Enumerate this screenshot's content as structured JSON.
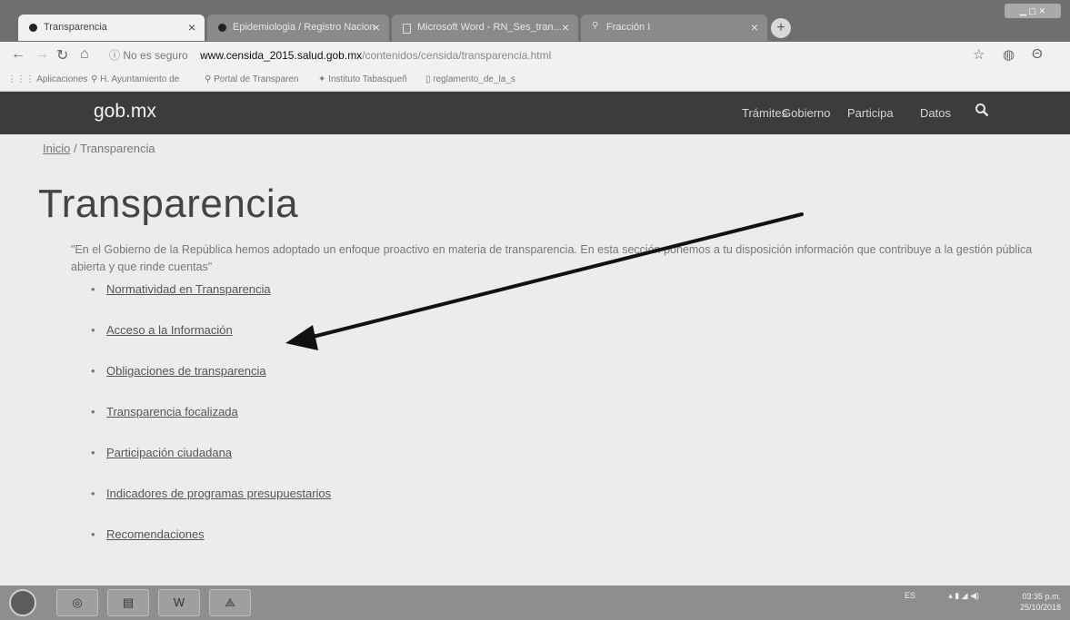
{
  "browser": {
    "tabs": [
      {
        "title": "Transparencia",
        "icon": "gob-favicon",
        "active": true
      },
      {
        "title": "Epidemiologia / Registro Nacion",
        "icon": "gob-favicon",
        "active": false
      },
      {
        "title": "Microsoft Word - RN_Ses_tran...",
        "icon": "document-icon",
        "active": false
      },
      {
        "title": "Fracción I",
        "icon": "link-icon",
        "active": false
      }
    ],
    "new_tab_symbol": "+",
    "address": {
      "security_label": "No es seguro",
      "host": "www.censida_2015.salud.gob.mx",
      "path": "/contenidos/censida/transparencia.html"
    },
    "bookmarks": [
      "Aplicaciones",
      "H. Ayuntamiento de",
      "Portal de Transparen",
      "Instituto Tabasqueñ",
      "reglamento_de_la_s"
    ]
  },
  "site": {
    "logo": "gob.mx",
    "nav": [
      "Trámites",
      "Gobierno",
      "Participa",
      "Datos"
    ],
    "breadcrumb": {
      "home": "Inicio",
      "separator": "/",
      "current": "Transparencia"
    },
    "title": "Transparencia",
    "intro": "\"En el Gobierno de la República hemos adoptado un enfoque proactivo en materia de transparencia. En esta sección ponemos a tu disposición información que contribuye a la gestión pública abierta y que rinde cuentas\"",
    "links": [
      "Normatividad en Transparencia",
      "Acceso a la Información",
      "Obligaciones de transparencia",
      "Transparencia focalizada",
      "Participación ciudadana",
      "Indicadores de programas presupuestarios",
      "Recomendaciones"
    ]
  },
  "taskbar": {
    "apps": [
      "chrome-icon",
      "file-explorer-icon",
      "word-icon",
      "pdf-reader-icon"
    ],
    "tray": "ES",
    "time": "03:35 p.m.",
    "date": "25/10/2018"
  }
}
